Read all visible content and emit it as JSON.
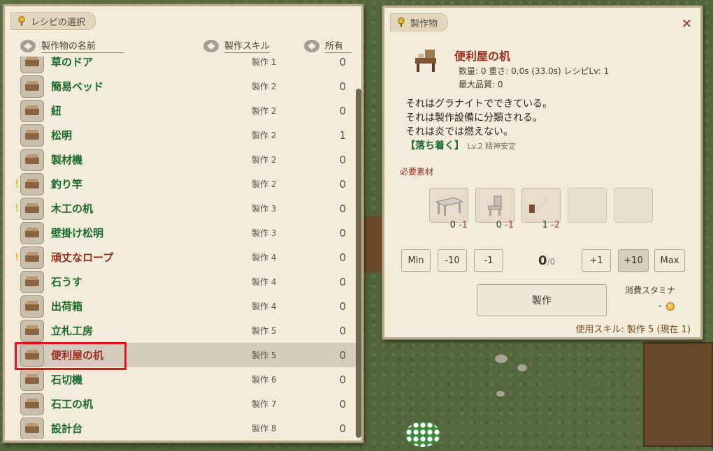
{
  "recipe_panel": {
    "title": "レシピの選択",
    "columns": {
      "name": "製作物の名前",
      "skill": "製作スキル",
      "owned": "所有"
    },
    "rows": [
      {
        "name": "草のドア",
        "skill": "製作 1",
        "owned": "0",
        "color": "green",
        "alert": false,
        "icon": "door-icon"
      },
      {
        "name": "簡易ベッド",
        "skill": "製作 2",
        "owned": "0",
        "color": "green",
        "alert": false,
        "icon": "bed-icon"
      },
      {
        "name": "紐",
        "skill": "製作 2",
        "owned": "0",
        "color": "green",
        "alert": false,
        "icon": "rope-icon"
      },
      {
        "name": "松明",
        "skill": "製作 2",
        "owned": "1",
        "color": "green",
        "alert": false,
        "icon": "torch-icon"
      },
      {
        "name": "製材機",
        "skill": "製作 2",
        "owned": "0",
        "color": "green",
        "alert": false,
        "icon": "sawmill-icon"
      },
      {
        "name": "釣り竿",
        "skill": "製作 2",
        "owned": "0",
        "color": "green",
        "alert": true,
        "icon": "fishing-rod-icon"
      },
      {
        "name": "木工の机",
        "skill": "製作 3",
        "owned": "0",
        "color": "green",
        "alert": true,
        "icon": "workbench-icon"
      },
      {
        "name": "壁掛け松明",
        "skill": "製作 3",
        "owned": "0",
        "color": "green",
        "alert": false,
        "icon": "wall-torch-icon"
      },
      {
        "name": "頑丈なロープ",
        "skill": "製作 4",
        "owned": "0",
        "color": "red",
        "alert": true,
        "icon": "rope-coil-icon"
      },
      {
        "name": "石うす",
        "skill": "製作 4",
        "owned": "0",
        "color": "green",
        "alert": false,
        "icon": "millstone-icon"
      },
      {
        "name": "出荷箱",
        "skill": "製作 4",
        "owned": "0",
        "color": "green",
        "alert": false,
        "icon": "crate-icon"
      },
      {
        "name": "立札工房",
        "skill": "製作 5",
        "owned": "0",
        "color": "green",
        "alert": false,
        "icon": "sign-workshop-icon"
      },
      {
        "name": "便利屋の机",
        "skill": "製作 5",
        "owned": "0",
        "color": "red",
        "alert": false,
        "icon": "handyman-desk-icon",
        "selected": true
      },
      {
        "name": "石切機",
        "skill": "製作 6",
        "owned": "0",
        "color": "green",
        "alert": false,
        "icon": "stonecutter-icon"
      },
      {
        "name": "石工の机",
        "skill": "製作 7",
        "owned": "0",
        "color": "green",
        "alert": false,
        "icon": "mason-table-icon"
      },
      {
        "name": "設計台",
        "skill": "製作 8",
        "owned": "0",
        "color": "green",
        "alert": false,
        "icon": "design-table-icon"
      }
    ]
  },
  "craft_panel": {
    "title": "製作物",
    "item_name": "便利屋の机",
    "meta_line1": "数量: 0  重さ: 0.0s (33.0s)  レシピLv: 1",
    "meta_line2": "最大品質: 0",
    "desc": [
      "それはグラナイトでできている。",
      "それは製作設備に分類される。",
      "それは炎では燃えない。"
    ],
    "trait": "【落ち着く】",
    "trait_sub": "Lv.2 精神安定",
    "materials_label": "必要素材",
    "materials": [
      {
        "icon": "table-material-icon",
        "have": "0",
        "need": "-1"
      },
      {
        "icon": "chair-material-icon",
        "have": "0",
        "need": "-1"
      },
      {
        "icon": "bone-material-icon",
        "have": "1",
        "need": "-2"
      }
    ],
    "buttons": {
      "min": "Min",
      "m10": "-10",
      "m1": "-1",
      "p1": "+1",
      "p10": "+10",
      "max": "Max"
    },
    "quantity": "0",
    "quantity_max": "/0",
    "craft_label": "製作",
    "stamina_label": "消費スタミナ",
    "stamina_value": "-",
    "skill_footer": "使用スキル: 製作 5 (現在 1)",
    "close_icon": "×"
  },
  "colors": {
    "green": "#1c6b2c",
    "red": "#9b2c1e",
    "highlight": "#e4121a"
  }
}
